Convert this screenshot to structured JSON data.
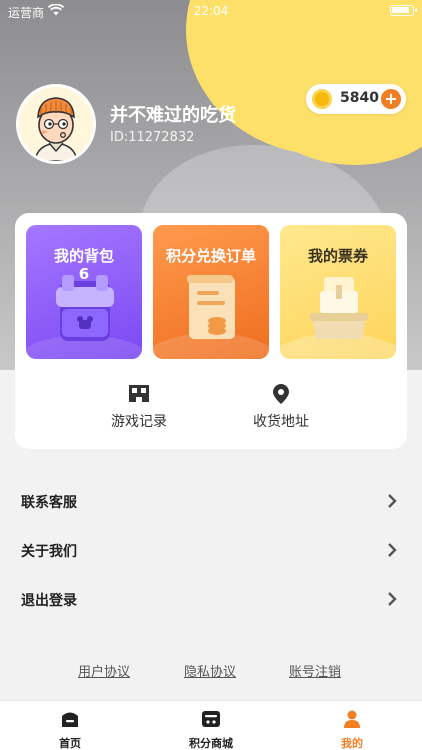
{
  "status_bar": {
    "carrier": "运营商",
    "time": "22:04"
  },
  "profile": {
    "nickname": "并不难过的吃货",
    "user_id": "ID:11272832"
  },
  "points": {
    "value": "5840",
    "add_label": "+"
  },
  "tiles": [
    {
      "label": "我的背包",
      "sub": "6"
    },
    {
      "label": "积分兑换订单"
    },
    {
      "label": "我的票券"
    }
  ],
  "quick_actions": [
    {
      "label": "游戏记录",
      "icon": "game-record-icon"
    },
    {
      "label": "收货地址",
      "icon": "location-pin-icon"
    }
  ],
  "menu": [
    {
      "label": "联系客服"
    },
    {
      "label": "关于我们"
    },
    {
      "label": "退出登录"
    }
  ],
  "footer_links": [
    {
      "label": "用户协议"
    },
    {
      "label": "隐私协议"
    },
    {
      "label": "账号注销"
    }
  ],
  "tabbar": [
    {
      "label": "首页",
      "icon": "home-icon"
    },
    {
      "label": "积分商城",
      "icon": "store-icon"
    },
    {
      "label": "我的",
      "icon": "person-icon",
      "active": true
    }
  ],
  "colors": {
    "accent": "#f07e22",
    "yellow": "#fde06a",
    "purple": "#8a5af6",
    "orange": "#f5822e"
  }
}
